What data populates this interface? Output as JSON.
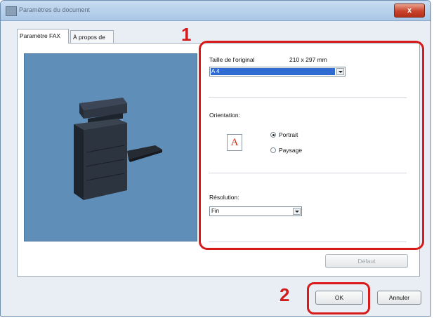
{
  "window": {
    "title": "Paramètres du document",
    "close_glyph": "x"
  },
  "tabs": [
    {
      "label": "Paramètre FAX",
      "active": true
    },
    {
      "label": "À propos de",
      "active": false
    }
  ],
  "callouts": {
    "one": "1",
    "two": "2"
  },
  "settings": {
    "size_label": "Taille de l'original",
    "size_dims": "210 x 297 mm",
    "size_value": "A 4",
    "orientation_label": "Orientation:",
    "orientation_icon_letter": "A",
    "portrait_label": "Portrait",
    "landscape_label": "Paysage",
    "orientation_selected": "Portrait",
    "resolution_label": "Résolution:",
    "resolution_value": "Fin"
  },
  "buttons": {
    "default_label": "Défaut",
    "ok_label": "OK",
    "cancel_label": "Annuler"
  },
  "colors": {
    "highlight": "#d81a1a",
    "preview_bg": "#5f8fb9",
    "selection": "#2f6bd1"
  }
}
